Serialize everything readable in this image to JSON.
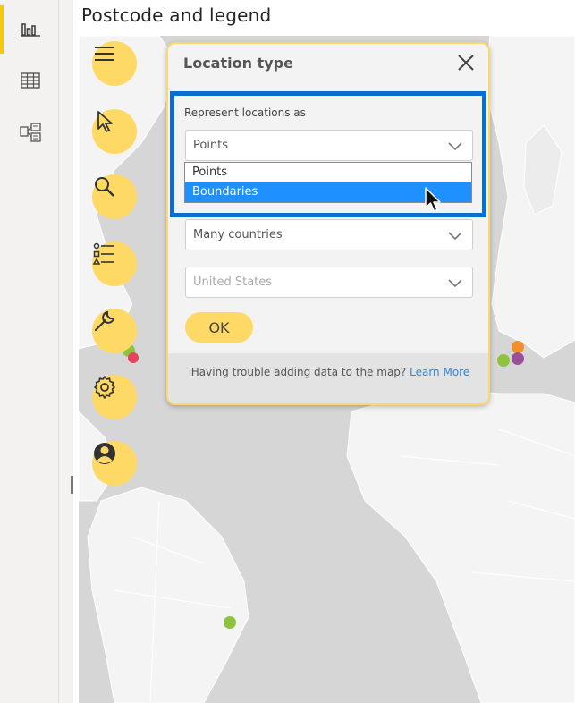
{
  "rail": {
    "items": [
      {
        "name": "report-view",
        "icon": "bar-chart-icon",
        "active": true
      },
      {
        "name": "data-view",
        "icon": "table-icon",
        "active": false
      },
      {
        "name": "model-view",
        "icon": "model-icon",
        "active": false
      }
    ],
    "accent": "#f2c811"
  },
  "visual": {
    "title": "Postcode and legend"
  },
  "toolbar": {
    "items": [
      "menu-icon",
      "cursor-icon",
      "search-icon",
      "legend-list-icon",
      "wrench-icon",
      "gear-icon",
      "user-icon"
    ],
    "color": "#ffd966"
  },
  "dialog": {
    "title": "Location type",
    "field_label": "Represent locations as",
    "represent_select": {
      "value": "Points"
    },
    "options": [
      "Points",
      "Boundaries"
    ],
    "highlighted_option": "Boundaries",
    "countries_select": {
      "value": "Many countries"
    },
    "country_select": {
      "value": "United States"
    },
    "ok_label": "OK",
    "help_text": "Having trouble adding data to the map?",
    "help_link": "Learn More"
  },
  "colors": {
    "highlight_border": "#0a6ed1",
    "selected_option": "#1e90ff",
    "map_land": "#f4f4f4",
    "map_water": "#d6d6d6"
  }
}
